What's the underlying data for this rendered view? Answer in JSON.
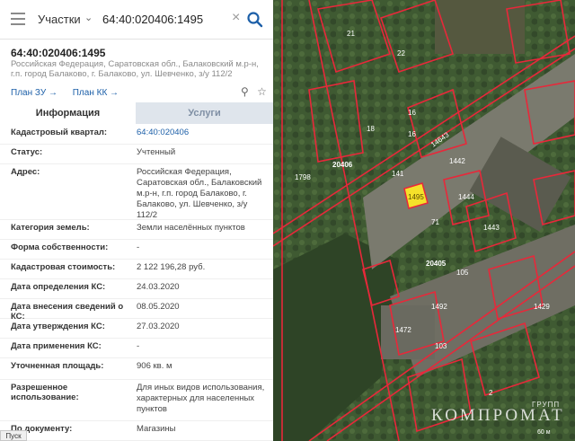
{
  "search": {
    "type_label": "Участки",
    "value": "64:40:020406:1495"
  },
  "object": {
    "title": "64:40:020406:1495",
    "address_short": "Российская Федерация, Саратовская обл., Балаковский м.р-н, г.п. город Балаково, г. Балаково, ул. Шевченко, з/у 112/2"
  },
  "links": {
    "plan_zu": "План ЗУ →",
    "plan_kk": "План КК →"
  },
  "tabs": {
    "info": "Информация",
    "services": "Услуги"
  },
  "rows": [
    {
      "key": "Кадастровый квартал:",
      "value": "64:40:020406"
    },
    {
      "key": "Статус:",
      "value": "Учтенный"
    },
    {
      "key": "Адрес:",
      "value": "Российская Федерация, Саратовская обл., Балаковский м.р-н, г.п. город Балаково, г. Балаково, ул. Шевченко, з/у 112/2"
    },
    {
      "key": "Категория земель:",
      "value": "Земли населённых пунктов"
    },
    {
      "key": "Форма собственности:",
      "value": "-"
    },
    {
      "key": "Кадастровая стоимость:",
      "value": "2 122 196,28 руб."
    },
    {
      "key": "Дата определения КС:",
      "value": "24.03.2020"
    },
    {
      "key": "Дата внесения сведений о КС:",
      "value": "08.05.2020"
    },
    {
      "key": "Дата утверждения КС:",
      "value": "27.03.2020"
    },
    {
      "key": "Дата применения КС:",
      "value": "-"
    },
    {
      "key": "Уточненная площадь:",
      "value": "906 кв. м"
    },
    {
      "key": "Разрешенное использование:",
      "value": "Для иных видов использования, характерных для населенных пунктов"
    },
    {
      "key": "По документу:",
      "value": "Магазины"
    }
  ],
  "statusbar": {
    "start": "Пуск"
  },
  "map": {
    "labels": [
      "21",
      "22",
      "16",
      "18",
      "16",
      "14643",
      "1442",
      "1798",
      "141",
      "1495",
      "1444",
      "71",
      "1443",
      "105",
      "1492",
      "1429",
      "1472",
      "103",
      "2",
      "20405",
      "20406"
    ],
    "watermark": "КОМПРОМАТ",
    "watermark_small": "ГРУПП",
    "scale": "60 м"
  },
  "colors": {
    "accent": "#1c5fa8",
    "parcel_line": "#e8283a",
    "highlight": "#f5e12a"
  }
}
